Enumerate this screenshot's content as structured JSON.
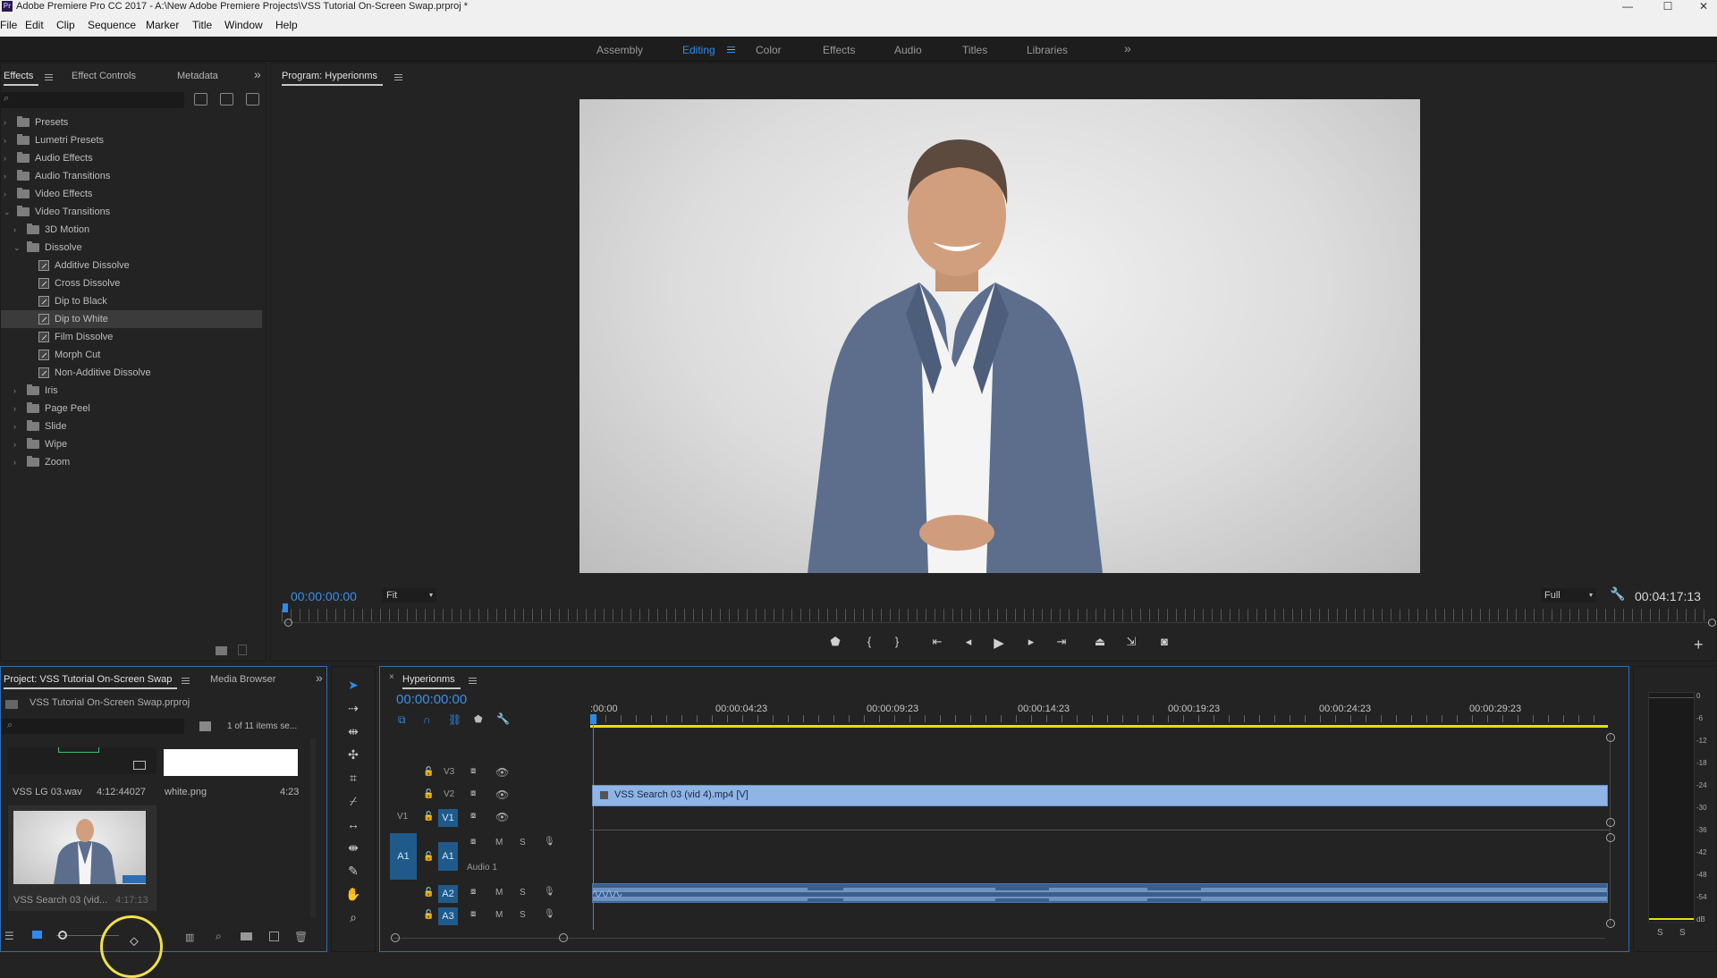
{
  "window": {
    "title": "Adobe Premiere Pro CC 2017 - A:\\New Adobe Premiere Projects\\VSS Tutorial On-Screen Swap.prproj *",
    "app_icon": "Pr"
  },
  "menu": [
    "File",
    "Edit",
    "Clip",
    "Sequence",
    "Marker",
    "Title",
    "Window",
    "Help"
  ],
  "workspaces": {
    "items": [
      "Assembly",
      "Editing",
      "Color",
      "Effects",
      "Audio",
      "Titles",
      "Libraries"
    ],
    "active": "Editing",
    "more": "»"
  },
  "effects_panel": {
    "tabs": [
      "Effects",
      "Effect Controls",
      "Metadata"
    ],
    "more": "»",
    "tree": [
      {
        "label": "Presets",
        "type": "folder",
        "level": 0,
        "expanded": false
      },
      {
        "label": "Lumetri Presets",
        "type": "folder",
        "level": 0,
        "expanded": false
      },
      {
        "label": "Audio Effects",
        "type": "folder",
        "level": 0,
        "expanded": false
      },
      {
        "label": "Audio Transitions",
        "type": "folder",
        "level": 0,
        "expanded": false
      },
      {
        "label": "Video Effects",
        "type": "folder",
        "level": 0,
        "expanded": false
      },
      {
        "label": "Video Transitions",
        "type": "folder",
        "level": 0,
        "expanded": true
      },
      {
        "label": "3D Motion",
        "type": "folder",
        "level": 1,
        "expanded": false
      },
      {
        "label": "Dissolve",
        "type": "folder",
        "level": 1,
        "expanded": true
      },
      {
        "label": "Additive Dissolve",
        "type": "effect",
        "level": 2
      },
      {
        "label": "Cross Dissolve",
        "type": "effect",
        "level": 2
      },
      {
        "label": "Dip to Black",
        "type": "effect",
        "level": 2
      },
      {
        "label": "Dip to White",
        "type": "effect",
        "level": 2,
        "selected": true
      },
      {
        "label": "Film Dissolve",
        "type": "effect",
        "level": 2
      },
      {
        "label": "Morph Cut",
        "type": "effect",
        "level": 2
      },
      {
        "label": "Non-Additive Dissolve",
        "type": "effect",
        "level": 2
      },
      {
        "label": "Iris",
        "type": "folder",
        "level": 1,
        "expanded": false
      },
      {
        "label": "Page Peel",
        "type": "folder",
        "level": 1,
        "expanded": false
      },
      {
        "label": "Slide",
        "type": "folder",
        "level": 1,
        "expanded": false
      },
      {
        "label": "Wipe",
        "type": "folder",
        "level": 1,
        "expanded": false
      },
      {
        "label": "Zoom",
        "type": "folder",
        "level": 1,
        "expanded": false
      }
    ]
  },
  "program_monitor": {
    "title": "Program: Hyperionms",
    "timecode_left": "00:00:00:00",
    "fit": "Fit",
    "quality": "Full",
    "timecode_right": "00:04:17:13",
    "add_button": "+"
  },
  "project_panel": {
    "tabs": [
      "Project: VSS Tutorial On-Screen Swap",
      "Media Browser"
    ],
    "more": "»",
    "project_file": "VSS Tutorial On-Screen Swap.prproj",
    "items_count": "1 of 11 items se...",
    "items": [
      {
        "name": "VSS LG 03.wav",
        "duration": "4:12:44027"
      },
      {
        "name": "white.png",
        "duration": "4:23"
      },
      {
        "name": "VSS Search 03 (vid...",
        "duration": "4:17:13"
      }
    ]
  },
  "timeline": {
    "sequence_name": "Hyperionms",
    "timecode": "00:00:00:00",
    "ruler": [
      ":00:00",
      "00:00:04:23",
      "00:00:09:23",
      "00:00:14:23",
      "00:00:19:23",
      "00:00:24:23",
      "00:00:29:23"
    ],
    "video_tracks": [
      "V3",
      "V2",
      "V1"
    ],
    "source_video": "V1",
    "audio_tracks": [
      "A1",
      "A2",
      "A3"
    ],
    "source_audio": "A1",
    "audio_track_name": "Audio 1",
    "m_label": "M",
    "s_label": "S",
    "video_clip": "VSS Search 03 (vid 4).mp4 [V]"
  },
  "audio_meter": {
    "scale": [
      "0",
      "-6",
      "-12",
      "-18",
      "-24",
      "-30",
      "-36",
      "-42",
      "-48",
      "-54",
      "dB"
    ],
    "solo_left": "S",
    "solo_right": "S"
  },
  "colors": {
    "accent": "#2d8ceb",
    "timecode": "#3b8ee8",
    "clip_video": "#8fb4e6",
    "clip_audio": "#3a5f8c",
    "work_area": "#e8e000"
  }
}
